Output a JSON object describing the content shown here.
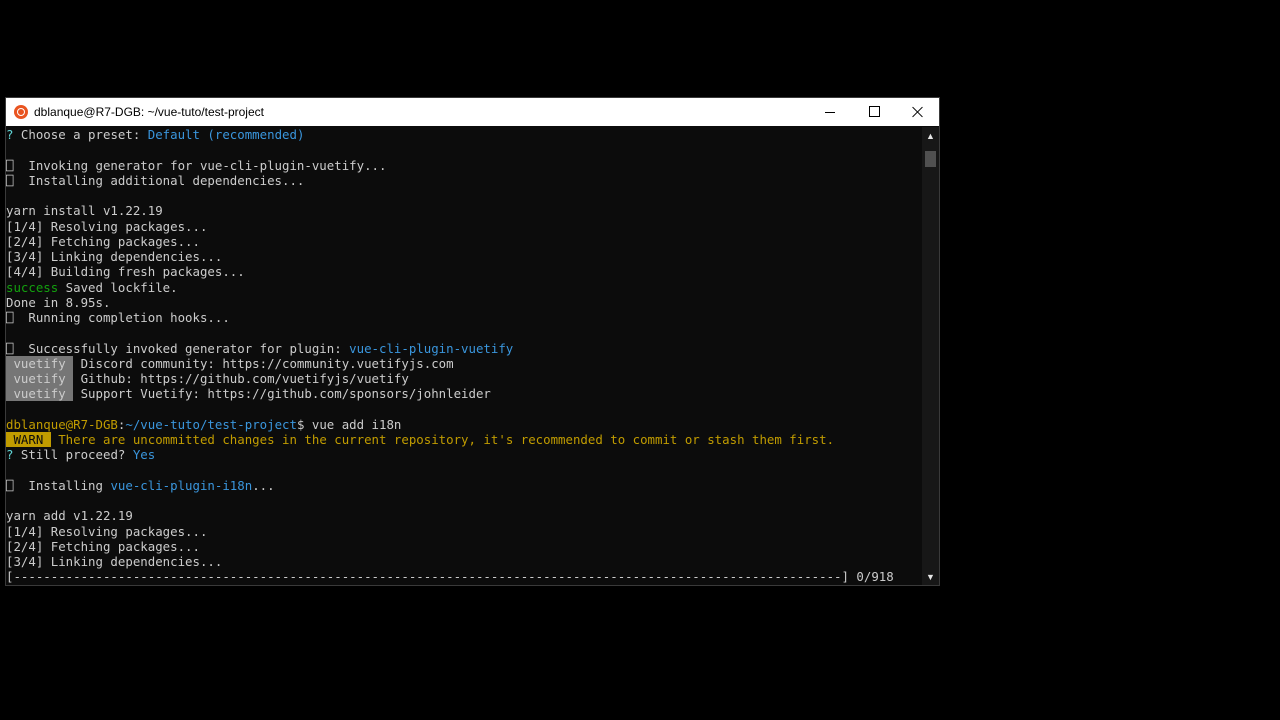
{
  "window": {
    "title": "dblanque@R7-DGB: ~/vue-tuto/test-project"
  },
  "terminal": {
    "lines": [
      [
        {
          "t": "? ",
          "c": "c-q"
        },
        {
          "t": "Choose a preset: ",
          "c": ""
        },
        {
          "t": "Default (recommended)",
          "c": "c-cyan"
        }
      ],
      [],
      [
        {
          "t": "⎕  Invoking generator for vue-cli-plugin-vuetify...",
          "c": ""
        }
      ],
      [
        {
          "t": "⎕  Installing additional dependencies...",
          "c": ""
        }
      ],
      [],
      [
        {
          "t": "yarn install v1.22.19",
          "c": ""
        }
      ],
      [
        {
          "t": "[1/4] Resolving packages...",
          "c": ""
        }
      ],
      [
        {
          "t": "[2/4] Fetching packages...",
          "c": ""
        }
      ],
      [
        {
          "t": "[3/4] Linking dependencies...",
          "c": ""
        }
      ],
      [
        {
          "t": "[4/4] Building fresh packages...",
          "c": ""
        }
      ],
      [
        {
          "t": "success",
          "c": "c-g"
        },
        {
          "t": " Saved lockfile.",
          "c": ""
        }
      ],
      [
        {
          "t": "Done in 8.95s.",
          "c": ""
        }
      ],
      [
        {
          "t": "⎕  Running completion hooks...",
          "c": ""
        }
      ],
      [],
      [
        {
          "t": "⎕  Successfully invoked generator for plugin: ",
          "c": ""
        },
        {
          "t": "vue-cli-plugin-vuetify",
          "c": "c-cyan"
        }
      ],
      [
        {
          "t": " vuetify ",
          "c": "badge-v"
        },
        {
          "t": " Discord community: https://community.vuetifyjs.com",
          "c": ""
        }
      ],
      [
        {
          "t": " vuetify ",
          "c": "badge-v"
        },
        {
          "t": " Github: https://github.com/vuetifyjs/vuetify",
          "c": ""
        }
      ],
      [
        {
          "t": " vuetify ",
          "c": "badge-v"
        },
        {
          "t": " Support Vuetify: https://github.com/sponsors/johnleider",
          "c": ""
        }
      ],
      [],
      [
        {
          "t": "dblanque@R7-DGB",
          "c": "c-prompt"
        },
        {
          "t": ":",
          "c": ""
        },
        {
          "t": "~/vue-tuto/test-project",
          "c": "c-cyan"
        },
        {
          "t": "$ vue add i18n",
          "c": ""
        }
      ],
      [
        {
          "t": " WARN ",
          "c": "badge-w"
        },
        {
          "t": " There are uncommitted changes in the current repository, it's recommended to commit or stash them first.",
          "c": "c-y"
        }
      ],
      [
        {
          "t": "? ",
          "c": "c-q"
        },
        {
          "t": "Still proceed? ",
          "c": ""
        },
        {
          "t": "Yes",
          "c": "c-cyan"
        }
      ],
      [],
      [
        {
          "t": "⎕  Installing ",
          "c": ""
        },
        {
          "t": "vue-cli-plugin-i18n",
          "c": "c-cyan"
        },
        {
          "t": "...",
          "c": ""
        }
      ],
      [],
      [
        {
          "t": "yarn add v1.22.19",
          "c": ""
        }
      ],
      [
        {
          "t": "[1/4] Resolving packages...",
          "c": ""
        }
      ],
      [
        {
          "t": "[2/4] Fetching packages...",
          "c": ""
        }
      ],
      [
        {
          "t": "[3/4] Linking dependencies...",
          "c": ""
        }
      ],
      [
        {
          "t": "[---------------------------------------------------------------------------------------------------------------] 0/918",
          "c": ""
        }
      ]
    ]
  },
  "icons": {
    "app": "ubuntu-icon",
    "minimize": "minimize-icon",
    "maximize": "maximize-icon",
    "close": "close-icon",
    "scroll_up": "chevron-up-icon",
    "scroll_down": "chevron-down-icon"
  },
  "colors": {
    "terminal_bg": "#0c0c0c",
    "text": "#cccccc",
    "cyan": "#3a96dd",
    "green": "#13a10e",
    "yellow": "#c19c00",
    "badge_gray": "#767676"
  }
}
